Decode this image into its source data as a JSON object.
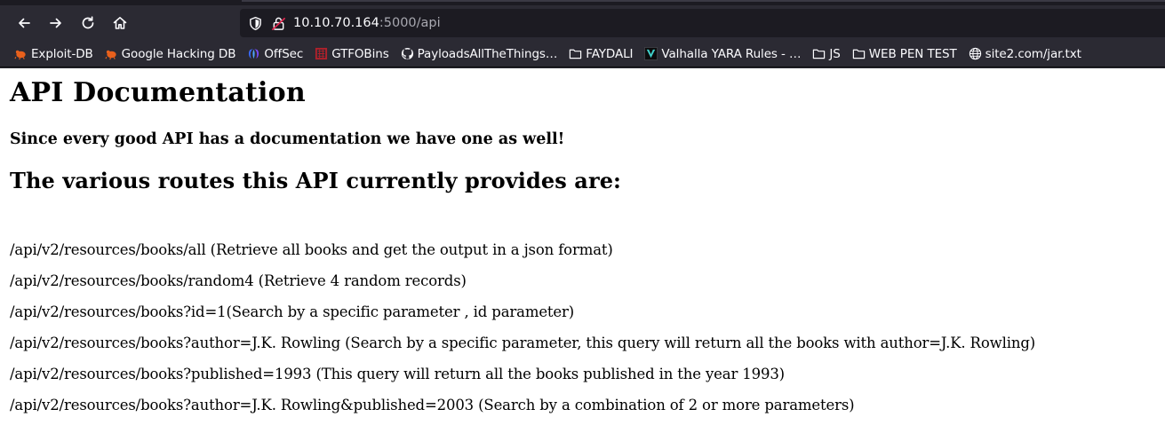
{
  "browser": {
    "url_host": "10.10.70.164",
    "url_rest": ":5000/api",
    "bookmarks": [
      {
        "label": "Exploit-DB",
        "icon": "exploitdb-bug-icon"
      },
      {
        "label": "Google Hacking DB",
        "icon": "ghdb-bug-icon"
      },
      {
        "label": "OffSec",
        "icon": "offsec-logo-icon"
      },
      {
        "label": "GTFOBins",
        "icon": "gtfobins-icon"
      },
      {
        "label": "PayloadsAllTheThings…",
        "icon": "github-icon"
      },
      {
        "label": "FAYDALI",
        "icon": "folder-icon"
      },
      {
        "label": "Valhalla YARA Rules - …",
        "icon": "valhalla-icon"
      },
      {
        "label": "JS",
        "icon": "folder-icon"
      },
      {
        "label": "WEB PEN TEST",
        "icon": "folder-icon"
      },
      {
        "label": "site2.com/jar.txt",
        "icon": "globe-icon"
      }
    ]
  },
  "page": {
    "title": "API Documentation",
    "subtitle": "Since every good API has a documentation we have one as well!",
    "routes_heading": "The various routes this API currently provides are:",
    "routes": [
      "/api/v2/resources/books/all (Retrieve all books and get the output in a json format)",
      "/api/v2/resources/books/random4 (Retrieve 4 random records)",
      "/api/v2/resources/books?id=1(Search by a specific parameter , id parameter)",
      "/api/v2/resources/books?author=J.K. Rowling (Search by a specific parameter, this query will return all the books with author=J.K. Rowling)",
      "/api/v2/resources/books?published=1993 (This query will return all the books published in the year 1993)",
      "/api/v2/resources/books?author=J.K. Rowling&published=2003 (Search by a combination of 2 or more parameters)"
    ]
  }
}
